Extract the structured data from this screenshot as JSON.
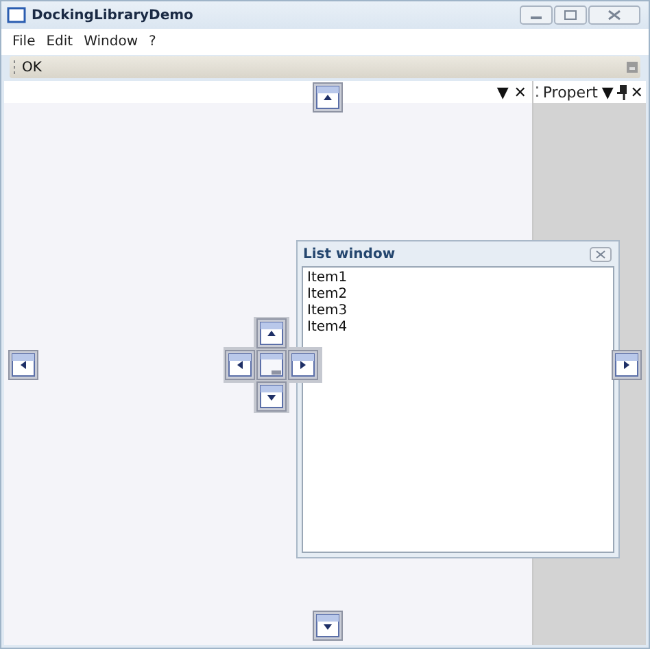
{
  "window": {
    "title": "DockingLibraryDemo"
  },
  "menu": [
    "File",
    "Edit",
    "Window",
    "?"
  ],
  "toolbar": {
    "button": "OK"
  },
  "document_pane": {
    "buttons": [
      "▼",
      "✕"
    ]
  },
  "properties_pane": {
    "title": "Propert",
    "buttons": [
      "▼",
      "✕"
    ]
  },
  "list_window": {
    "title": "List window",
    "items": [
      "Item1",
      "Item2",
      "Item3",
      "Item4"
    ]
  }
}
